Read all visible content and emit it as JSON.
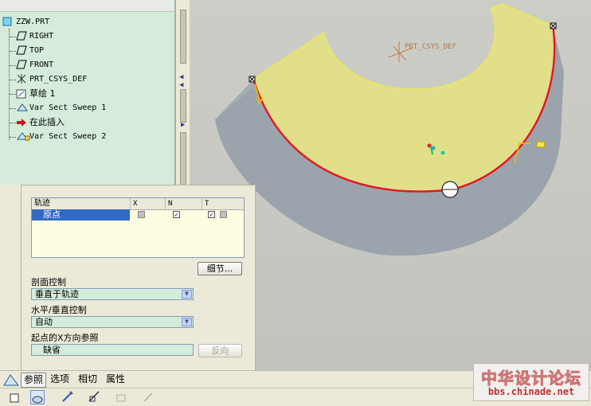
{
  "model_tree": {
    "root": "ZZW.PRT",
    "items": [
      {
        "label": "RIGHT",
        "icon": "datum-plane-icon"
      },
      {
        "label": "TOP",
        "icon": "datum-plane-icon"
      },
      {
        "label": "FRONT",
        "icon": "datum-plane-icon"
      },
      {
        "label": "PRT_CSYS_DEF",
        "icon": "coordinate-system-icon"
      },
      {
        "label": "草绘 1",
        "icon": "sketch-icon"
      },
      {
        "label": "Var Sect Sweep 1",
        "icon": "sweep-feature-icon"
      },
      {
        "label": "在此插入",
        "icon": "insert-here-arrow-icon"
      },
      {
        "label": "Var Sect Sweep 2",
        "icon": "sweep-feature-icon"
      }
    ]
  },
  "graphics": {
    "csys_label": "PRT_CSYS_DEF",
    "colors": {
      "surface_top": "#e3e08a",
      "surface_side": "#9aa3ac",
      "trajectory": "#e8121e",
      "edge": "#f0ef47"
    }
  },
  "dashboard": {
    "table": {
      "headers": [
        "轨迹",
        "X",
        "N",
        "T"
      ],
      "rows": [
        {
          "name": "原点",
          "x": false,
          "n": true,
          "t": true
        }
      ]
    },
    "details_button": "细节...",
    "section_control_label": "剖面控制",
    "section_control_value": "垂直于轨迹",
    "hv_control_label": "水平/垂直控制",
    "hv_control_value": "自动",
    "x_ref_label": "起点的X方向参照",
    "x_ref_value": "缺省",
    "flip_button": "反向"
  },
  "tabs": [
    "参照",
    "选项",
    "相切",
    "属性"
  ],
  "active_tab": "参照",
  "watermark": {
    "title": "中华设计论坛",
    "url": "bbs.chinade.net"
  }
}
